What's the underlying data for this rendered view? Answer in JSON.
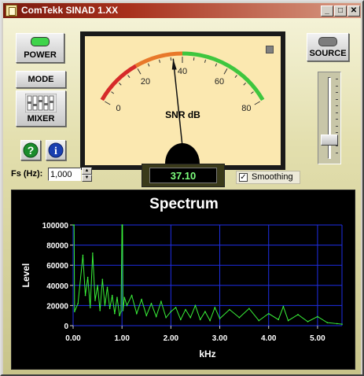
{
  "window": {
    "title": "ComTekk SINAD 1.XX",
    "minimize": "_",
    "maximize": "□",
    "close": "✕"
  },
  "controls": {
    "power_label": "POWER",
    "mode_label": "MODE",
    "mixer_label": "MIXER",
    "source_label": "SOURCE",
    "help_glyph": "?",
    "info_glyph": "i",
    "power_led_color": "#3ed44a"
  },
  "meter": {
    "unit_label": "SNR dB",
    "scale_labels": [
      "0",
      "20",
      "40",
      "60",
      "80"
    ],
    "scale_min": 0,
    "scale_max": 80,
    "needle_value": 36,
    "zones": [
      {
        "from": 0,
        "to": 20,
        "color": "#d62a2a"
      },
      {
        "from": 20,
        "to": 40,
        "color": "#e8782a"
      },
      {
        "from": 40,
        "to": 80,
        "color": "#3ec63e"
      }
    ]
  },
  "source_slider": {
    "position": 0.18
  },
  "sampling": {
    "label": "Fs (Hz):",
    "value": "1,000"
  },
  "readout": {
    "value": "37.10"
  },
  "smoothing": {
    "label": "Smoothing",
    "checked": true,
    "check_glyph": "✓"
  },
  "chart_data": {
    "type": "line",
    "title": "Spectrum",
    "xlabel": "kHz",
    "ylabel": "Level",
    "xlim": [
      0,
      5.5
    ],
    "ylim": [
      0,
      100000
    ],
    "x_ticks": [
      "0.00",
      "1.00",
      "2.00",
      "3.00",
      "4.00",
      "5.00"
    ],
    "y_ticks": [
      "0",
      "20000",
      "40000",
      "60000",
      "80000",
      "100000"
    ],
    "grid": true,
    "line_color": "#39f039",
    "grid_color": "#1e2ee6",
    "series": [
      {
        "x": [
          0,
          0.02,
          0.03,
          0.1,
          0.2,
          0.25,
          0.3,
          0.35,
          0.4,
          0.45,
          0.5,
          0.55,
          0.6,
          0.65,
          0.7,
          0.75,
          0.8,
          0.85,
          0.9,
          0.95,
          0.98,
          1.0,
          1.01,
          1.02,
          1.05,
          1.1,
          1.2,
          1.3,
          1.4,
          1.5,
          1.6,
          1.7,
          1.8,
          1.9,
          2.0,
          2.1,
          2.2,
          2.3,
          2.4,
          2.5,
          2.6,
          2.7,
          2.8,
          2.9,
          3.0,
          3.2,
          3.4,
          3.6,
          3.8,
          4.0,
          4.2,
          4.3,
          4.4,
          4.6,
          4.8,
          5.0,
          5.2,
          5.4,
          5.5
        ],
        "y": [
          100000,
          100000,
          14000,
          22000,
          70000,
          30000,
          48000,
          18000,
          72000,
          25000,
          40000,
          15000,
          46000,
          20000,
          38000,
          17000,
          30000,
          12000,
          28000,
          10000,
          14000,
          100000,
          100000,
          15000,
          28000,
          20000,
          30000,
          12000,
          26000,
          10000,
          22000,
          9000,
          24000,
          8000,
          14000,
          18000,
          6000,
          16000,
          8000,
          20000,
          6000,
          14000,
          5000,
          18000,
          7000,
          16000,
          8000,
          17000,
          5000,
          12000,
          6000,
          19000,
          5000,
          11000,
          4000,
          9000,
          3000,
          2000,
          1500
        ]
      }
    ]
  }
}
